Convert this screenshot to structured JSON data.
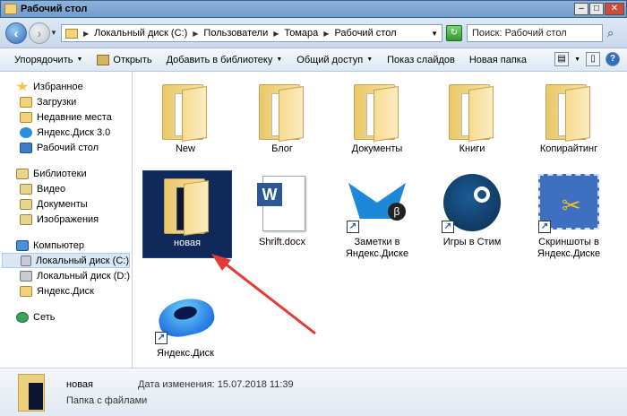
{
  "window": {
    "title": "Рабочий стол"
  },
  "window_buttons": {
    "minimize": "–",
    "maximize": "□",
    "close": "✕"
  },
  "address": {
    "crumbs": [
      "Локальный диск (C:)",
      "Пользователи",
      "Томара",
      "Рабочий стол"
    ],
    "search_placeholder": "Поиск: Рабочий стол"
  },
  "toolbar": {
    "organize": "Упорядочить",
    "open": "Открыть",
    "add_library": "Добавить в библиотеку",
    "share": "Общий доступ",
    "slideshow": "Показ слайдов",
    "new_folder": "Новая папка"
  },
  "nav": {
    "favorites": {
      "label": "Избранное",
      "items": [
        "Загрузки",
        "Недавние места",
        "Яндекс.Диск 3.0",
        "Рабочий стол"
      ]
    },
    "libraries": {
      "label": "Библиотеки",
      "items": [
        "Видео",
        "Документы",
        "Изображения"
      ]
    },
    "computer": {
      "label": "Компьютер",
      "items": [
        "Локальный диск (C:)",
        "Локальный диск (D:)",
        "Яндекс.Диск"
      ]
    },
    "network": {
      "label": "Сеть"
    }
  },
  "files": {
    "row1": [
      "New",
      "Блог",
      "Документы",
      "Книги",
      "Копирайтинг"
    ],
    "novaya": "новая",
    "shrift": "Shrift.docx",
    "zametki": "Заметки в Яндекс.Диске",
    "steam": "Игры в Стим",
    "skrinshoty": "Скриншоты в Яндекс.Диске",
    "yadisk": "Яндекс.Диск"
  },
  "status": {
    "name": "новая",
    "date_label": "Дата изменения:",
    "date_value": "15.07.2018 11:39",
    "type": "Папка с файлами"
  },
  "colors": {
    "selection": "#0f2a5a",
    "arrow": "#e53935",
    "accent": "#2e6db4"
  }
}
